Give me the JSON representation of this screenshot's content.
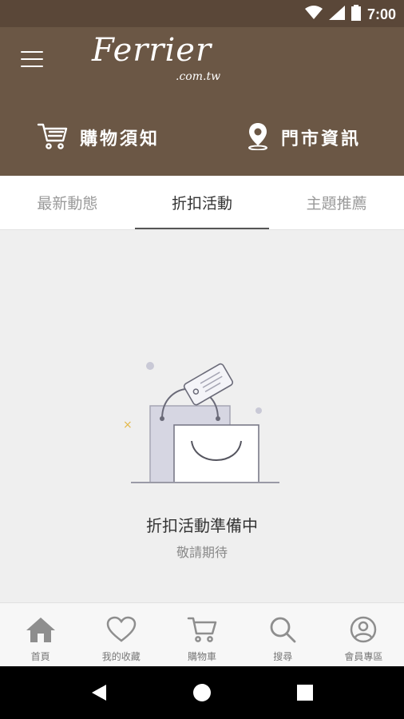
{
  "status": {
    "time": "7:00"
  },
  "brand": {
    "wordmark": "Ferrier",
    "domain": ".com.tw"
  },
  "header": {
    "shopping_info_label": "購物須知",
    "store_info_label": "門市資訊"
  },
  "tabs": [
    {
      "label": "最新動態",
      "active": false
    },
    {
      "label": "折扣活動",
      "active": true
    },
    {
      "label": "主題推薦",
      "active": false
    }
  ],
  "empty_state": {
    "title": "折扣活動準備中",
    "subtitle": "敬請期待"
  },
  "bottom_nav": [
    {
      "label": "首頁",
      "icon": "home-icon"
    },
    {
      "label": "我的收藏",
      "icon": "heart-icon"
    },
    {
      "label": "購物車",
      "icon": "cart-icon"
    },
    {
      "label": "搜尋",
      "icon": "search-icon"
    },
    {
      "label": "會員專區",
      "icon": "user-icon"
    }
  ],
  "colors": {
    "header_bg": "#6b5745",
    "statusbar_bg": "#5a4738",
    "content_bg": "#efefef",
    "active_tab_text": "#333333"
  }
}
